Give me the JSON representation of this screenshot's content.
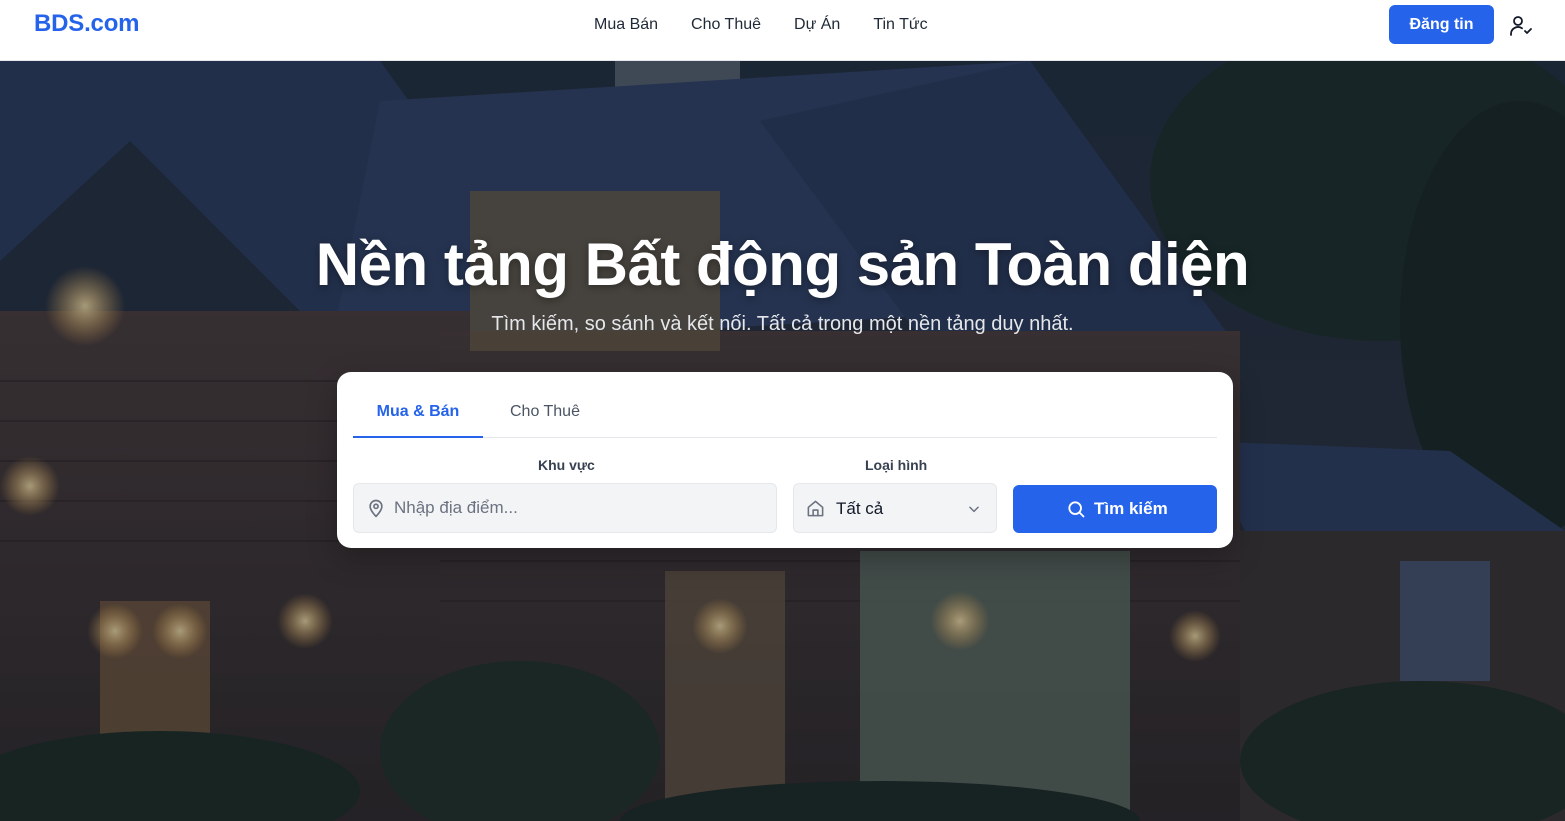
{
  "header": {
    "logo": "BDS.com",
    "nav": [
      "Mua Bán",
      "Cho Thuê",
      "Dự Án",
      "Tin Tức"
    ],
    "post_label": "Đăng tin",
    "user_icon": "user-check-icon"
  },
  "hero": {
    "title": "Nền tảng Bất động sản Toàn diện",
    "subtitle": "Tìm kiếm, so sánh và kết nối. Tất cả trong một nền tảng duy nhất."
  },
  "search": {
    "tabs": [
      {
        "label": "Mua & Bán",
        "active": true
      },
      {
        "label": "Cho Thuê",
        "active": false
      }
    ],
    "area_label": "Khu vực",
    "area_placeholder": "Nhập địa điểm...",
    "type_label": "Loại hình",
    "type_value": "Tất cả",
    "submit_label": "Tìm kiếm"
  },
  "colors": {
    "primary": "#2563eb",
    "text": "#111827",
    "hero_overlay": "#141c2d"
  }
}
